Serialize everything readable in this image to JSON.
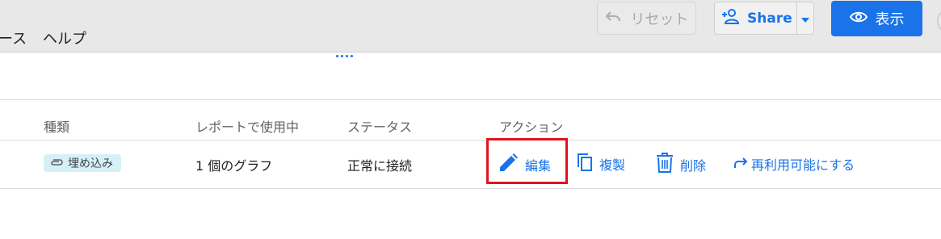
{
  "menu": {
    "items": [
      "ース",
      "ヘルプ"
    ]
  },
  "toolbar": {
    "reset_label": "リセット",
    "share_label": "Share",
    "view_label": "表示"
  },
  "table": {
    "headers": [
      "種類",
      "レポートで使用中",
      "ステータス",
      "アクション"
    ],
    "rows": [
      {
        "type_chip": "埋め込み",
        "used_in_report": "1 個のグラフ",
        "status": "正常に接続",
        "actions": {
          "edit": "編集",
          "copy": "複製",
          "delete": "削除",
          "reuse": "再利用可能にする"
        }
      }
    ]
  },
  "colors": {
    "accent": "#1a73e8",
    "highlight": "#e0141e",
    "chip_bg": "#d6f0f8",
    "topbar_bg": "#e8e8e8"
  }
}
